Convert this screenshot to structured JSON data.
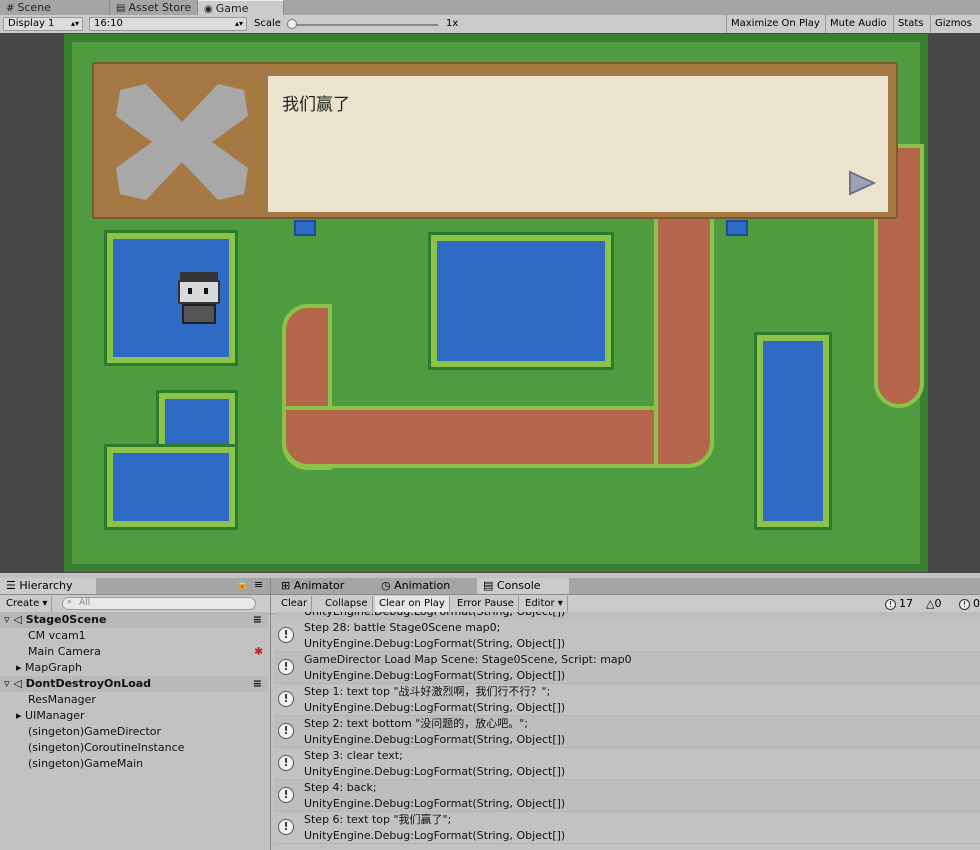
{
  "top_tabs": [
    {
      "label": "Scene",
      "icon": "grid-icon"
    },
    {
      "label": "Asset Store",
      "icon": "store-icon"
    },
    {
      "label": "Game",
      "icon": "game-icon"
    }
  ],
  "game_toolbar": {
    "display": "Display 1",
    "aspect": "16:10",
    "scale_label": "Scale",
    "scale_value": "1x",
    "maximize": "Maximize On Play",
    "mute": "Mute Audio",
    "stats": "Stats",
    "gizmos": "Gizmos"
  },
  "dialog": {
    "text": "我们赢了"
  },
  "hierarchy": {
    "tab": "Hierarchy",
    "create": "Create",
    "search_placeholder": "All",
    "items": [
      {
        "label": "Stage0Scene",
        "type": "scene"
      },
      {
        "label": "CM vcam1",
        "type": "item"
      },
      {
        "label": "Main Camera",
        "type": "item"
      },
      {
        "label": "MapGraph",
        "type": "foldout"
      },
      {
        "label": "DontDestroyOnLoad",
        "type": "scene"
      },
      {
        "label": "ResManager",
        "type": "item"
      },
      {
        "label": "UIManager",
        "type": "foldout"
      },
      {
        "label": "(singeton)GameDirector",
        "type": "item"
      },
      {
        "label": "(singeton)CoroutineInstance",
        "type": "item"
      },
      {
        "label": "(singeton)GameMain",
        "type": "item"
      }
    ]
  },
  "console_tabs": [
    {
      "label": "Animator",
      "icon": "animator-icon"
    },
    {
      "label": "Animation",
      "icon": "clock-icon"
    },
    {
      "label": "Console",
      "icon": "console-icon"
    }
  ],
  "console_toolbar": {
    "clear": "Clear",
    "collapse": "Collapse",
    "clear_on_play": "Clear on Play",
    "error_pause": "Error Pause",
    "editor": "Editor",
    "info_count": "17",
    "warn_count": "0",
    "error_count": "0"
  },
  "console_rows": [
    {
      "l1": "Step 28: battle Stage0Scene map0;",
      "l2": "UnityEngine.Debug:LogFormat(String, Object[])"
    },
    {
      "l1": "GameDirector Load Map Scene: Stage0Scene, Script: map0",
      "l2": "UnityEngine.Debug:LogFormat(String, Object[])"
    },
    {
      "l1": "Step 1: text top \"战斗好激烈啊，我们行不行？\";",
      "l2": "UnityEngine.Debug:LogFormat(String, Object[])"
    },
    {
      "l1": "Step 2: text bottom \"没问题的，放心吧。\";",
      "l2": "UnityEngine.Debug:LogFormat(String, Object[])"
    },
    {
      "l1": "Step 3: clear text;",
      "l2": "UnityEngine.Debug:LogFormat(String, Object[])"
    },
    {
      "l1": "Step 4: back;",
      "l2": "UnityEngine.Debug:LogFormat(String, Object[])"
    },
    {
      "l1": "Step 6: text top \"我们赢了\";",
      "l2": "UnityEngine.Debug:LogFormat(String, Object[])"
    }
  ],
  "console_cut_row": "UnityEngine.Debug:LogFormat(String, Object[])"
}
